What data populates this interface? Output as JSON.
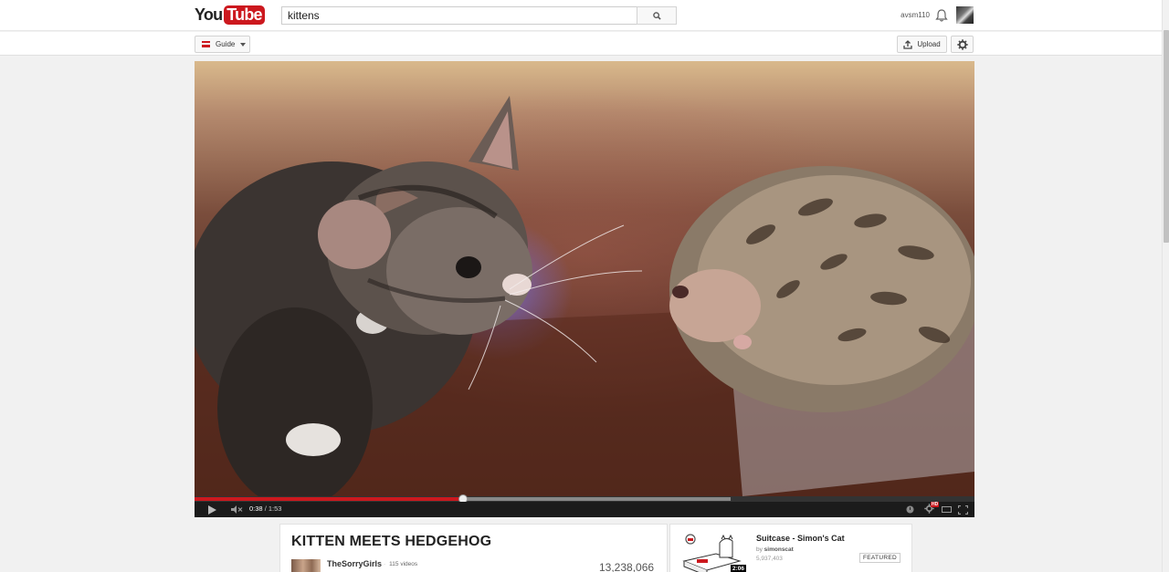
{
  "masthead": {
    "logo_you": "You",
    "logo_tube": "Tube",
    "search_value": "kittens",
    "username": "avsm110"
  },
  "subbar": {
    "guide_label": "Guide",
    "upload_label": "Upload"
  },
  "player": {
    "current_time": "0:38",
    "separator": " / ",
    "duration": "1:53",
    "played_fraction": 0.344,
    "loaded_fraction": 0.687,
    "hd_badge": "HD"
  },
  "video": {
    "title": "KITTEN MEETS HEDGEHOG",
    "channel": "TheSorryGirls",
    "video_count": "115 videos",
    "views": "13,238,066"
  },
  "sidebar": {
    "featured_title": "Suitcase - Simon's Cat",
    "by_prefix": "by ",
    "channel": "simonscat",
    "views": "5,937,403",
    "duration": "2:06",
    "badge": "FEATURED"
  },
  "colors": {
    "brand_red": "#cc181e",
    "background": "#f1f1f1"
  }
}
